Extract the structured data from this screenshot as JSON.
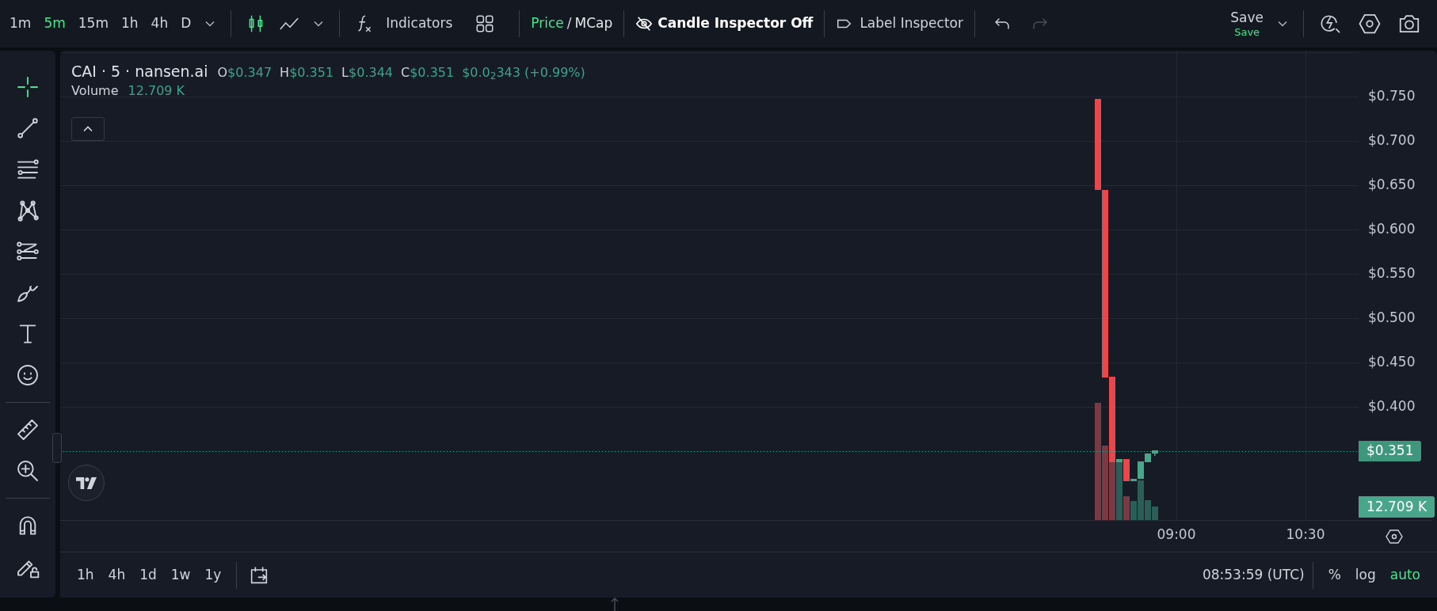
{
  "timeframes": [
    {
      "label": "1m",
      "selected": false
    },
    {
      "label": "5m",
      "selected": true
    },
    {
      "label": "15m",
      "selected": false
    },
    {
      "label": "1h",
      "selected": false
    },
    {
      "label": "4h",
      "selected": false
    },
    {
      "label": "D",
      "selected": false
    }
  ],
  "chart_types": [
    {
      "kind": "candles",
      "selected": true
    },
    {
      "kind": "line",
      "selected": false
    }
  ],
  "indicators": "Indicators",
  "price_mode": [
    {
      "label": "Price",
      "selected": true
    },
    {
      "label": "MCap",
      "selected": false
    }
  ],
  "price_mode_separator": "/",
  "candle_inspector": "Candle Inspector Off",
  "label_inspector": "Label Inspector",
  "history": [
    {
      "kind": "undo",
      "disabled": false
    },
    {
      "kind": "redo",
      "disabled": true
    }
  ],
  "save": {
    "label": "Save",
    "status": "Save"
  },
  "tool_groups": [
    {
      "tools": [
        {
          "kind": "crosshair",
          "selected": true
        },
        {
          "kind": "trend-line",
          "selected": false
        },
        {
          "kind": "fib",
          "selected": false
        },
        {
          "kind": "pattern",
          "selected": false
        },
        {
          "kind": "projection",
          "selected": false
        },
        {
          "kind": "brush",
          "selected": false
        },
        {
          "kind": "text",
          "selected": false
        },
        {
          "kind": "smiley",
          "selected": false
        }
      ]
    },
    {
      "tools": [
        {
          "kind": "ruler",
          "selected": false
        },
        {
          "kind": "zoom",
          "selected": false
        }
      ]
    },
    {
      "tools": [
        {
          "kind": "magnet",
          "selected": false
        },
        {
          "kind": "lock",
          "selected": false
        }
      ]
    }
  ],
  "legend": {
    "symbol": "CAI · 5 · nansen.ai",
    "ohlc": [
      {
        "key": "O",
        "value": "$0.347"
      },
      {
        "key": "H",
        "value": "$0.351"
      },
      {
        "key": "L",
        "value": "$0.344"
      },
      {
        "key": "C",
        "value": "$0.351"
      }
    ],
    "change": "$0.0$_{2}$343 (+0.99%)"
  },
  "volume": {
    "label": "Volume",
    "value": "12.709 K"
  },
  "price_axis": [
    "$0.750",
    "$0.700",
    "$0.650",
    "$0.600",
    "$0.550",
    "$0.500",
    "$0.450",
    "$0.400"
  ],
  "last_price": "$0.351",
  "last_volume": "12.709 K",
  "time_axis": [
    "09:00",
    "10:30"
  ],
  "ranges": [
    "1h",
    "4h",
    "1d",
    "1w",
    "1y"
  ],
  "clock": "08:53:59 (UTC)",
  "scale_options": [
    {
      "label": "%",
      "on": false
    },
    {
      "label": "log",
      "on": false
    },
    {
      "label": "auto",
      "on": true
    }
  ]
}
